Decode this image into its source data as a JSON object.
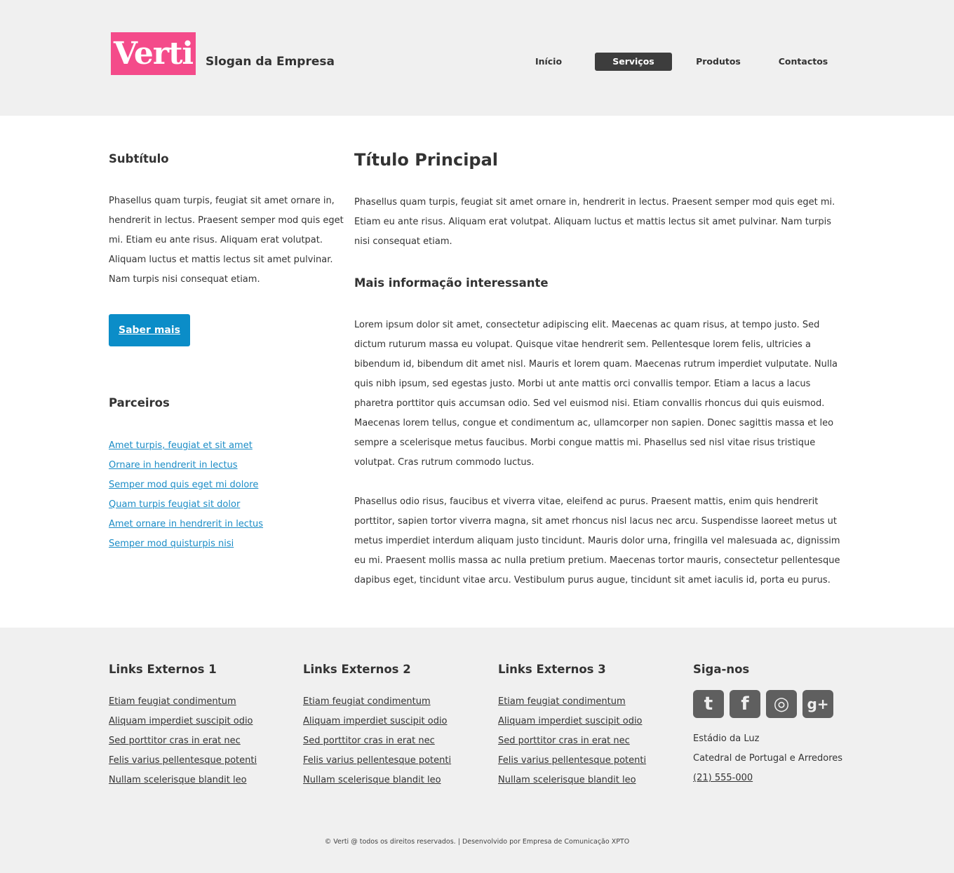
{
  "header": {
    "logo": "Verti",
    "slogan": "Slogan da Empresa",
    "nav": [
      "Início",
      "Serviços",
      "Produtos",
      "Contactos"
    ],
    "active_nav": "Serviços",
    "logo_color": "#f44b8a"
  },
  "sidebar": {
    "subtitle": "Subtítulo",
    "text": "Phasellus quam turpis, feugiat sit amet ornare in, hendrerit in lectus. Praesent semper mod quis eget mi. Etiam eu ante risus. Aliquam erat volutpat. Aliquam luctus et mattis lectus sit amet pulvinar. Nam turpis nisi consequat etiam.",
    "button": "Saber mais",
    "button_color": "#0b8dc8",
    "partners_title": "Parceiros",
    "partners": [
      "Amet turpis, feugiat et sit amet",
      "Ornare in hendrerit in lectus",
      "Semper mod quis eget mi dolore",
      "Quam turpis feugiat sit dolor",
      "Amet ornare in hendrerit in lectus",
      "Semper mod quisturpis nisi"
    ]
  },
  "content": {
    "title": "Título Principal",
    "p1": "Phasellus quam turpis, feugiat sit amet ornare in, hendrerit in lectus. Praesent semper mod quis eget mi. Etiam eu ante risus. Aliquam erat volutpat. Aliquam luctus et mattis lectus sit amet pulvinar. Nam turpis nisi consequat etiam.",
    "subheading": "Mais informação interessante",
    "p2": "Lorem ipsum dolor sit amet, consectetur adipiscing elit. Maecenas ac quam risus, at tempo justo. Sed dictum ruturum massa eu volupat. Quisque vitae hendrerit sem. Pellentesque lorem felis, ultricies a bibendum id, bibendum dit amet nisl. Mauris et lorem quam. Maecenas rutrum imperdiet vulputate. Nulla quis nibh ipsum, sed egestas justo. Morbi ut ante mattis orci convallis tempor. Etiam a lacus a lacus pharetra porttitor quis accumsan odio. Sed vel euismod nisi. Etiam convallis rhoncus dui quis euismod. Maecenas lorem tellus, congue et condimentum ac, ullamcorper non sapien. Donec sagittis massa et leo sempre a scelerisque metus faucibus. Morbi congue mattis mi. Phasellus sed nisl vitae risus tristique volutpat. Cras rutrum commodo luctus.",
    "p3": "Phasellus odio risus, faucibus et viverra vitae, eleifend ac purus. Praesent mattis, enim quis hendrerit porttitor, sapien tortor viverra magna, sit amet rhoncus nisl lacus nec arcu. Suspendisse laoreet metus ut metus imperdiet interdum aliquam justo tincidunt. Mauris dolor urna, fringilla vel malesuada ac, dignissim eu mi. Praesent mollis massa ac nulla pretium pretium. Maecenas tortor mauris, consectetur pellentesque dapibus eget, tincidunt vitae arcu. Vestibulum purus augue, tincidunt sit amet iaculis id, porta eu purus."
  },
  "footer": {
    "columns": [
      {
        "title": "Links Externos 1",
        "links": [
          "Etiam feugiat condimentum",
          "Aliquam imperdiet suscipit odio",
          "Sed porttitor cras in erat nec",
          "Felis varius pellentesque potenti",
          "Nullam scelerisque blandit leo"
        ]
      },
      {
        "title": "Links Externos 2",
        "links": [
          "Etiam feugiat condimentum",
          "Aliquam imperdiet suscipit odio",
          "Sed porttitor cras in erat nec",
          "Felis varius pellentesque potenti",
          "Nullam scelerisque blandit leo"
        ]
      },
      {
        "title": "Links Externos 3",
        "links": [
          "Etiam feugiat condimentum",
          "Aliquam imperdiet suscipit odio",
          "Sed porttitor cras in erat nec",
          "Felis varius pellentesque potenti",
          "Nullam scelerisque blandit leo"
        ]
      }
    ],
    "follow_title": "Siga-nos",
    "social_icons": [
      "twitter-icon",
      "facebook-icon",
      "dribbble-icon",
      "google-plus-icon"
    ],
    "address1": "Estádio da Luz",
    "address2": "Catedral de Portugal e Arredores",
    "phone": "(21) 555-000",
    "copyright": "© Verti @ todos os direitos reservados. | Desenvolvido por Empresa de Comunicação XPTO"
  }
}
